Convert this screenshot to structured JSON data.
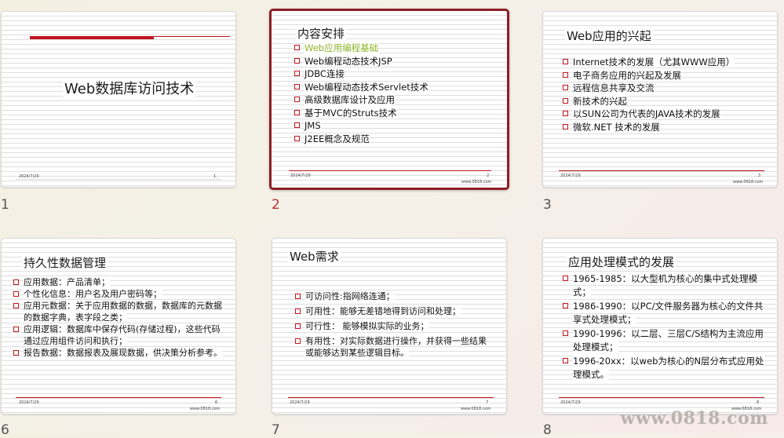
{
  "slides": [
    {
      "number": "1",
      "title": "Web数据库访问技术",
      "date": "2024/7/29",
      "page": "1"
    },
    {
      "number": "2",
      "title": "内容安排",
      "items": [
        "Web应用编程基础",
        "Web编程动态技术JSP",
        "JDBC连接",
        "Web编程动态技术Servlet技术",
        "高级数据库设计及应用",
        "基于MVC的Struts技术",
        "JMS",
        "J2EE概念及规范"
      ],
      "date": "2024/7/29",
      "page": "2",
      "site": "www.0818.com"
    },
    {
      "number": "3",
      "title": "Web应用的兴起",
      "items": [
        "Internet技术的发展（尤其WWW应用）",
        "电子商务应用的兴起及发展",
        "远程信息共享及交流",
        "新技术的兴起",
        "以SUN公司为代表的JAVA技术的发展",
        "微软.NET 技术的发展"
      ],
      "date": "2024/7/29",
      "page": "3",
      "site": "www.0818.com"
    },
    {
      "number": "6",
      "title": "持久性数据管理",
      "items": [
        "应用数据：产品清单；",
        "个性化信息：用户名及用户密码等；",
        "应用元数据：关于应用数据的数据，数据库的元数据的数据字典，表字段之类；",
        "应用逻辑：数据库中保存代码(存储过程)，这些代码通过应用组件访问和执行；",
        "报告数据：数据报表及展现数据，供决策分析参考。"
      ],
      "date": "2024/7/29",
      "page": "6",
      "site": "www.0818.com"
    },
    {
      "number": "7",
      "title": "Web需求",
      "items": [
        "可访问性:指网络连通；",
        "可用性：能够无差错地得到访问和处理；",
        "可行性： 能够模拟实际的业务；",
        "有用性：对实际数据进行操作，并获得一些结果或能够达到某些逻辑目标。"
      ],
      "date": "2024/7/29",
      "page": "7",
      "site": "www.0818.com"
    },
    {
      "number": "8",
      "title": "应用处理模式的发展",
      "items": [
        "1965-1985：以大型机为核心的集中式处理模式；",
        "1986-1990：以PC/文件服务器为核心的文件共享式处理模式；",
        "1990-1996：以二层、三层C/S结构为主流应用处理模式；",
        "1996-20xx：以web为核心的N层分布式应用处理模式。"
      ],
      "date": "2024/7/29",
      "page": "8",
      "site": "www.0818.com"
    }
  ],
  "watermark": "www.0818.com",
  "colors": {
    "accent": "#c0141e",
    "selected_border": "#8c1e26",
    "highlight": "#8fb42a"
  }
}
